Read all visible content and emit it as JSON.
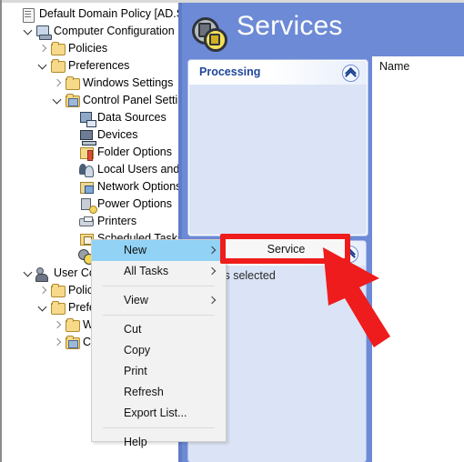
{
  "window": {
    "tree_pane_name": "group-policy-tree"
  },
  "tree": {
    "items": [
      {
        "label": "Default Domain Policy [AD.STD",
        "icon": "policy-document-icon",
        "indent": 0,
        "expander": "none"
      },
      {
        "label": "Computer Configuration",
        "icon": "computer-icon",
        "indent": 1,
        "expander": "down"
      },
      {
        "label": "Policies",
        "icon": "folder-icon",
        "indent": 2,
        "expander": "right"
      },
      {
        "label": "Preferences",
        "icon": "folder-icon",
        "indent": 2,
        "expander": "down"
      },
      {
        "label": "Windows Settings",
        "icon": "folder-icon",
        "indent": 3,
        "expander": "right"
      },
      {
        "label": "Control Panel Setting",
        "icon": "control-panel-folder-icon",
        "indent": 3,
        "expander": "down"
      },
      {
        "label": "Data Sources",
        "icon": "data-sources-icon",
        "indent": 4,
        "expander": "none"
      },
      {
        "label": "Devices",
        "icon": "devices-icon",
        "indent": 4,
        "expander": "none"
      },
      {
        "label": "Folder Options",
        "icon": "folder-options-icon",
        "indent": 4,
        "expander": "none"
      },
      {
        "label": "Local Users and C",
        "icon": "local-users-icon",
        "indent": 4,
        "expander": "none"
      },
      {
        "label": "Network Options",
        "icon": "network-options-icon",
        "indent": 4,
        "expander": "none"
      },
      {
        "label": "Power Options",
        "icon": "power-options-icon",
        "indent": 4,
        "expander": "none"
      },
      {
        "label": "Printers",
        "icon": "printers-icon",
        "indent": 4,
        "expander": "none"
      },
      {
        "label": "Scheduled Tasks",
        "icon": "scheduled-tasks-icon",
        "indent": 4,
        "expander": "none"
      },
      {
        "label": "",
        "icon": "services-gears-icon",
        "indent": 4,
        "expander": "none"
      },
      {
        "label": "User Conf",
        "icon": "user-icon",
        "indent": 1,
        "expander": "down"
      },
      {
        "label": "Policie",
        "icon": "folder-icon",
        "indent": 2,
        "expander": "right"
      },
      {
        "label": "Prefere",
        "icon": "folder-icon",
        "indent": 2,
        "expander": "down"
      },
      {
        "label": "Wi",
        "icon": "folder-icon",
        "indent": 3,
        "expander": "right"
      },
      {
        "label": "Co",
        "icon": "control-panel-folder-icon",
        "indent": 3,
        "expander": "right"
      }
    ]
  },
  "banner": {
    "title": "Services",
    "icon": "services-gears-icon"
  },
  "pad": {
    "title": "Processing",
    "collapse_icon": "chevron-up-icon"
  },
  "pad2": {
    "selection_text": "olicies selected",
    "collapse_icon": "chevron-up-icon"
  },
  "list_pane": {
    "column_header": "Name",
    "rows": []
  },
  "context_menu": {
    "items": [
      {
        "label": "New",
        "submenu": true,
        "selected": true,
        "separator_after": false
      },
      {
        "label": "All Tasks",
        "submenu": true,
        "selected": false,
        "separator_after": true
      },
      {
        "label": "View",
        "submenu": true,
        "selected": false,
        "separator_after": true
      },
      {
        "label": "Cut",
        "submenu": false,
        "selected": false,
        "separator_after": false
      },
      {
        "label": "Copy",
        "submenu": false,
        "selected": false,
        "separator_after": false
      },
      {
        "label": "Print",
        "submenu": false,
        "selected": false,
        "separator_after": false
      },
      {
        "label": "Refresh",
        "submenu": false,
        "selected": false,
        "separator_after": false
      },
      {
        "label": "Export List...",
        "submenu": false,
        "selected": false,
        "separator_after": true
      },
      {
        "label": "Help",
        "submenu": false,
        "selected": false,
        "separator_after": false
      }
    ]
  },
  "submenu": {
    "items": [
      {
        "label": "Service"
      }
    ]
  },
  "annotation": {
    "highlight_color": "#ee1c1c",
    "arrow_color": "#ee1c1c",
    "arrow_name": "red-pointer-arrow"
  },
  "colors": {
    "banner_blue": "#6d8ad6",
    "pad_body_blue": "#dbe4f6",
    "pad_title_blue": "#20479b",
    "menu_highlight": "#91d2f5"
  }
}
